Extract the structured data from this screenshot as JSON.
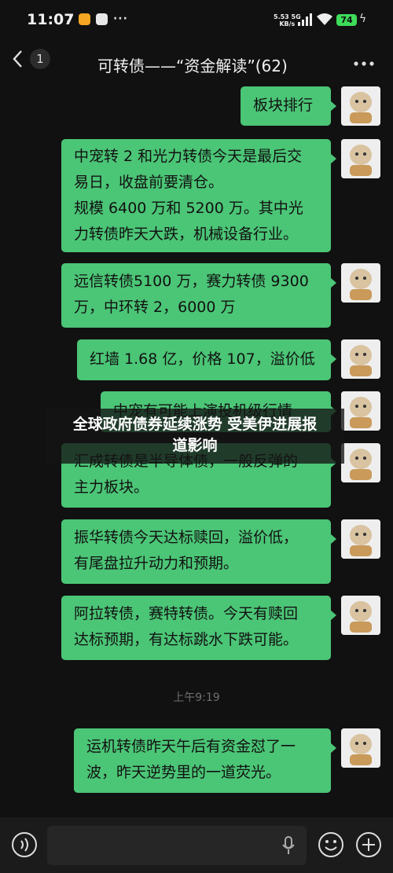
{
  "status_bar": {
    "time": "11:07",
    "net_speed_top": "5.53 5G",
    "net_speed_bottom": "KB/s",
    "battery": "74"
  },
  "header": {
    "back_count": "1",
    "title": "可转债——“资金解读”(62)"
  },
  "messages": [
    {
      "text": "板块排行"
    },
    {
      "text": "中宠转 2 和光力转债今天是最后交\n易日，收盘前要清仓。\n规模 6400 万和 5200 万。其中光\n力转债昨天大跌，机械设备行业。"
    },
    {
      "text": "远信转债5100 万，赛力转债 9300\n万，中环转 2，6000 万"
    },
    {
      "text": "红墙 1.68 亿，价格 107，溢价低"
    },
    {
      "text": "中宠有可能上演投机级行情"
    },
    {
      "text": "汇成转债是半导体债，一般反弹的\n主力板块。"
    },
    {
      "text": "振华转债今天达标赎回，溢价低，\n有尾盘拉升动力和预期。"
    },
    {
      "text": "阿拉转债，赛特转债。今天有赎回\n达标预期，有达标跳水下跌可能。"
    },
    {
      "text": "运机转债昨天午后有资金怼了一\n波，昨天逆势里的一道荧光。"
    }
  ],
  "timestamp": "上午9:19",
  "overlay": {
    "text": "全球政府债券延续涨势 受美伊进展报\n道影响"
  },
  "colors": {
    "bubble": "#4bc576",
    "background": "#111111",
    "battery": "#3ddc5a"
  },
  "icons": [
    "back-arrow-icon",
    "more-icon",
    "voice-icon",
    "mic-icon",
    "emoji-icon",
    "plus-icon",
    "signal-icon",
    "wifi-icon"
  ]
}
